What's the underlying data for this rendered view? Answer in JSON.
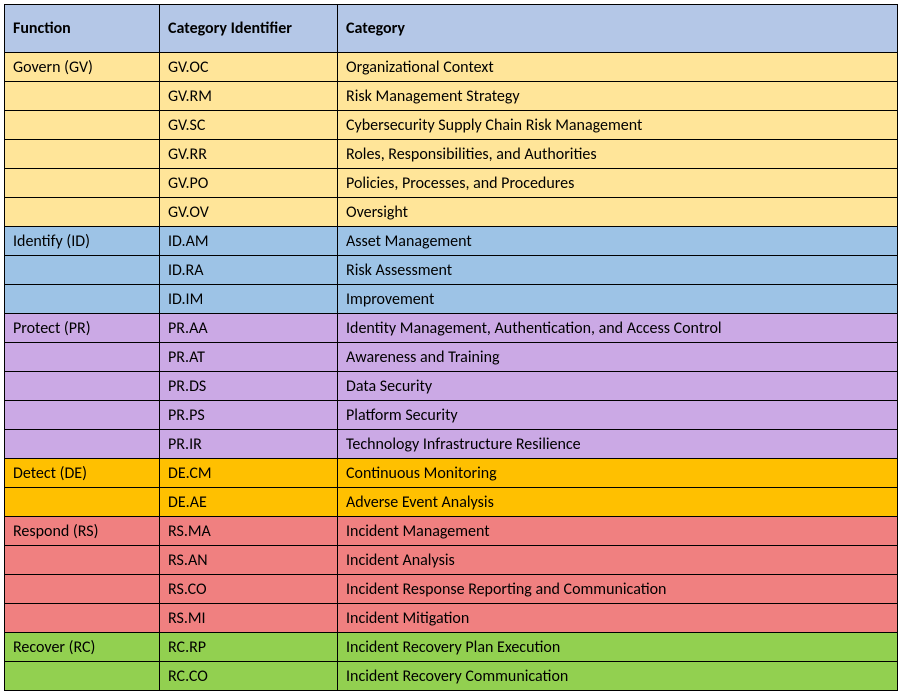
{
  "headers": {
    "function": "Function",
    "identifier": "Category Identifier",
    "category": "Category"
  },
  "functions": [
    {
      "label": "Govern (GV)",
      "colorClass": "bg-govern",
      "categories": [
        {
          "id": "GV.OC",
          "name": "Organizational Context"
        },
        {
          "id": "GV.RM",
          "name": "Risk Management Strategy"
        },
        {
          "id": "GV.SC",
          "name": "Cybersecurity Supply Chain Risk Management"
        },
        {
          "id": "GV.RR",
          "name": "Roles, Responsibilities, and Authorities"
        },
        {
          "id": "GV.PO",
          "name": "Policies, Processes, and Procedures"
        },
        {
          "id": "GV.OV",
          "name": "Oversight"
        }
      ]
    },
    {
      "label": "Identify (ID)",
      "colorClass": "bg-identify",
      "categories": [
        {
          "id": "ID.AM",
          "name": "Asset Management"
        },
        {
          "id": "ID.RA",
          "name": "Risk Assessment"
        },
        {
          "id": "ID.IM",
          "name": "Improvement"
        }
      ]
    },
    {
      "label": "Protect (PR)",
      "colorClass": "bg-protect",
      "categories": [
        {
          "id": "PR.AA",
          "name": "Identity Management, Authentication, and Access Control"
        },
        {
          "id": "PR.AT",
          "name": "Awareness and Training"
        },
        {
          "id": "PR.DS",
          "name": "Data Security"
        },
        {
          "id": "PR.PS",
          "name": "Platform Security"
        },
        {
          "id": "PR.IR",
          "name": "Technology Infrastructure Resilience"
        }
      ]
    },
    {
      "label": "Detect (DE)",
      "colorClass": "bg-detect",
      "categories": [
        {
          "id": "DE.CM",
          "name": "Continuous Monitoring"
        },
        {
          "id": "DE.AE",
          "name": "Adverse Event Analysis"
        }
      ]
    },
    {
      "label": "Respond (RS)",
      "colorClass": "bg-respond",
      "categories": [
        {
          "id": "RS.MA",
          "name": "Incident Management"
        },
        {
          "id": "RS.AN",
          "name": "Incident Analysis"
        },
        {
          "id": "RS.CO",
          "name": "Incident Response Reporting and Communication"
        },
        {
          "id": "RS.MI",
          "name": "Incident Mitigation"
        }
      ]
    },
    {
      "label": "Recover (RC)",
      "colorClass": "bg-recover",
      "categories": [
        {
          "id": "RC.RP",
          "name": "Incident Recovery Plan Execution"
        },
        {
          "id": "RC.CO",
          "name": "Incident Recovery Communication"
        }
      ]
    }
  ]
}
